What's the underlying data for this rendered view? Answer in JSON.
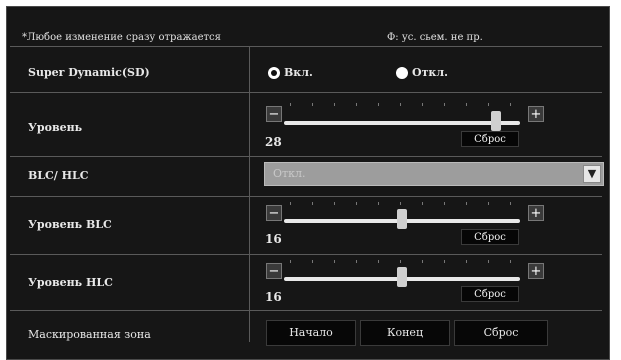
{
  "notice": {
    "left": "*Любое изменение сразу отражается",
    "right": "Ф: ус. сьем. не пр."
  },
  "rows": {
    "super_dynamic": {
      "label": "Super Dynamic(SD)",
      "options": [
        "Вкл.",
        "Откл."
      ],
      "selected": "Вкл."
    },
    "level": {
      "label": "Уровень",
      "value": "28",
      "fraction": 0.9,
      "reset_label": "Сброс"
    },
    "blc_hlc": {
      "label": "BLC/ HLC",
      "selected": "Откл."
    },
    "blc_level": {
      "label": "Уровень BLC",
      "value": "16",
      "fraction": 0.5,
      "reset_label": "Сброс"
    },
    "hlc_level": {
      "label": "Уровень HLC",
      "value": "16",
      "fraction": 0.5,
      "reset_label": "Сброс"
    },
    "mask_area": {
      "label": "Маскированная зона",
      "buttons": [
        "Начало",
        "Конец",
        "Сброс"
      ]
    }
  },
  "icons": {
    "minus": "minus-icon",
    "plus": "plus-icon",
    "dropdown": "chevron-down-icon"
  }
}
